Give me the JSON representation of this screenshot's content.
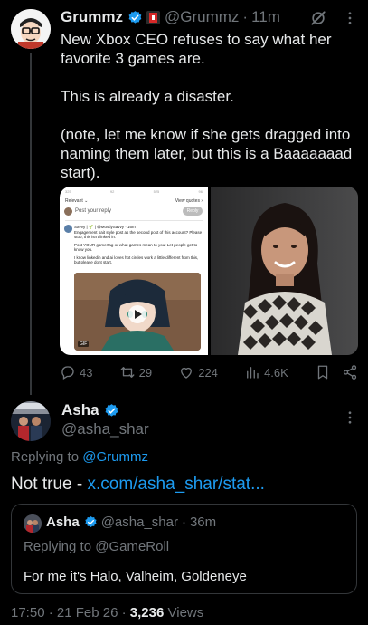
{
  "main_tweet": {
    "author_name": "Grummz",
    "handle": "@Grummz",
    "separator": "·",
    "time": "11m",
    "text_lines": [
      "New Xbox CEO refuses to say what her favorite 3 games are.",
      "This is already a disaster.",
      "(note, let me know if she gets dragged into naming them later, but this is a Baaaaaaad start)."
    ],
    "actions": {
      "replies": "43",
      "reposts": "29",
      "likes": "224",
      "views": "4.6K"
    }
  },
  "embedded_screenshot": {
    "stats": [
      "325",
      "92",
      "525",
      "96"
    ],
    "relevant_label": "Relevant ⌄",
    "view_quotes": "View quotes ›",
    "reply_placeholder": "Post your reply",
    "reply_button": "Reply",
    "author_line": "Savvy | 🌱 | @MostlySavvy · 16m",
    "body_1": "Engagement bait style post as the second post of this account? Please stop, this isn't linked in.",
    "body_2": "Post YOUR gamertag or what games mean to you! Let people get to know you.",
    "body_3": "I know linkedin and ai loves hot circles work a little different from this, but please dont start.",
    "gif_label": "GIF"
  },
  "reply_tweet": {
    "author_name": "Asha",
    "handle": "@asha_shar",
    "replying_prefix": "Replying to",
    "replying_mention": "@Grummz",
    "text_prefix": "Not true - ",
    "link": "x.com/asha_shar/stat..."
  },
  "quoted_tweet": {
    "author_name": "Asha",
    "handle": "@asha_shar",
    "separator": "·",
    "time": "36m",
    "replying": "Replying to @GameRoll_",
    "text": "For me it's Halo, Valheim, Goldeneye"
  },
  "meta": {
    "time": "17:50",
    "date": "21 Feb 26",
    "separator": "·",
    "views_count": "3,236",
    "views_label": "Views"
  },
  "colors": {
    "background": "#000000",
    "text": "#e7e9ea",
    "muted": "#71767b",
    "accent": "#1d9bf0",
    "border": "#333639"
  },
  "icons": [
    "verified-icon",
    "grok-icon",
    "more-icon",
    "reply-icon",
    "repost-icon",
    "like-icon",
    "views-icon",
    "bookmark-icon",
    "share-icon"
  ]
}
